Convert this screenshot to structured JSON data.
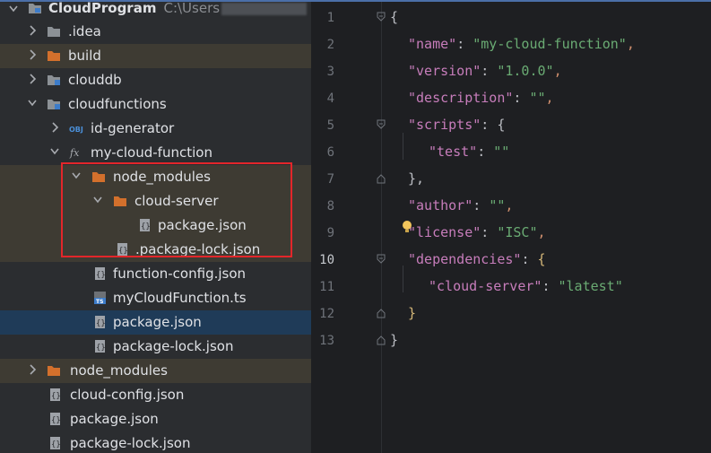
{
  "project": {
    "name": "CloudProgram",
    "path": "C:\\Users"
  },
  "tree": [
    {
      "label": ".idea",
      "icon": "folder-plain-icon",
      "expanded": false
    },
    {
      "label": "build",
      "icon": "folder-orange-icon",
      "expanded": false
    },
    {
      "label": "clouddb",
      "icon": "folder-db-icon",
      "expanded": false
    },
    {
      "label": "cloudfunctions",
      "icon": "folder-functions-icon",
      "expanded": true
    },
    {
      "label": "id-generator",
      "icon": "obj-icon",
      "expanded": false
    },
    {
      "label": "my-cloud-function",
      "icon": "fx-icon",
      "expanded": true
    },
    {
      "label": "node_modules",
      "icon": "folder-orange-icon",
      "expanded": true
    },
    {
      "label": "cloud-server",
      "icon": "folder-orange-icon",
      "expanded": true
    },
    {
      "label": "package.json",
      "icon": "json-file-icon"
    },
    {
      "label": ".package-lock.json",
      "icon": "json-file-icon"
    },
    {
      "label": "function-config.json",
      "icon": "json-file-icon"
    },
    {
      "label": "myCloudFunction.ts",
      "icon": "ts-file-icon"
    },
    {
      "label": "package.json",
      "icon": "json-file-icon",
      "selected": true
    },
    {
      "label": "package-lock.json",
      "icon": "json-file-icon"
    },
    {
      "label": "node_modules",
      "icon": "folder-orange-icon",
      "expanded": false
    },
    {
      "label": "cloud-config.json",
      "icon": "json-file-icon"
    },
    {
      "label": "package.json",
      "icon": "json-file-icon"
    },
    {
      "label": "package-lock.json",
      "icon": "json-file-icon"
    }
  ],
  "editor": {
    "current_line": 10,
    "line_numbers": [
      "1",
      "2",
      "3",
      "4",
      "5",
      "6",
      "7",
      "8",
      "9",
      "10",
      "11",
      "12",
      "13"
    ],
    "lines": [
      {
        "key": "",
        "value": "",
        "raw": "{"
      },
      {
        "key": "\"name\"",
        "value": "\"my-cloud-function\""
      },
      {
        "key": "\"version\"",
        "value": "\"1.0.0\""
      },
      {
        "key": "\"description\"",
        "value": "\"\""
      },
      {
        "key": "\"scripts\"",
        "raw_tail": "{"
      },
      {
        "key": "\"test\"",
        "value": "\"\""
      },
      {
        "raw": "},"
      },
      {
        "key": "\"author\"",
        "value": "\"\""
      },
      {
        "key": "\"license\"",
        "value": "\"ISC\""
      },
      {
        "key": "\"dependencies\"",
        "raw_tail": "{"
      },
      {
        "key": "\"cloud-server\"",
        "value": "\"latest\""
      },
      {
        "raw": "}"
      },
      {
        "raw": "}"
      }
    ]
  },
  "colors": {
    "highlight_box": "#e3262a",
    "selection": "#1f3b58",
    "json_key": "#c77dbb",
    "json_string": "#6aab73"
  }
}
